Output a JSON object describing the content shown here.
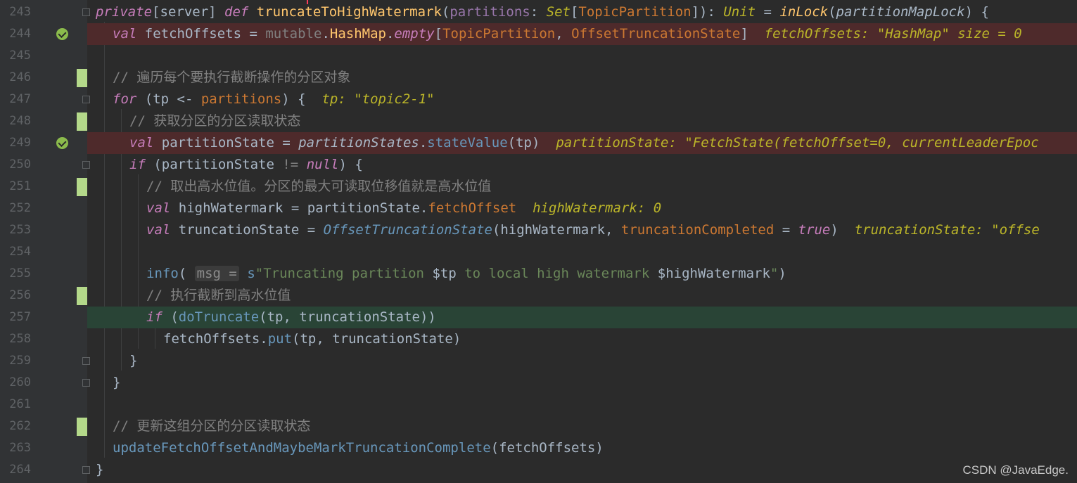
{
  "editor": {
    "lines": [
      {
        "num": "243",
        "code": "private[server] def truncateToHighWatermark(partitions: Set[TopicPartition]): Unit = inLock(partitionMapLock) {"
      },
      {
        "num": "244",
        "code": "val fetchOffsets = mutable.HashMap.empty[TopicPartition, OffsetTruncationState]",
        "hint": "fetchOffsets: \"HashMap\" size = 0"
      },
      {
        "num": "245",
        "code": ""
      },
      {
        "num": "246",
        "code": "// 遍历每个要执行截断操作的分区对象"
      },
      {
        "num": "247",
        "code": "for (tp <- partitions) {",
        "hint": "tp: \"topic2-1\""
      },
      {
        "num": "248",
        "code": "// 获取分区的分区读取状态"
      },
      {
        "num": "249",
        "code": "val partitionState = partitionStates.stateValue(tp)",
        "hint": "partitionState: \"FetchState(fetchOffset=0, currentLeaderEpoc"
      },
      {
        "num": "250",
        "code": "if (partitionState != null) {"
      },
      {
        "num": "251",
        "code": "// 取出高水位值。分区的最大可读取位移值就是高水位值"
      },
      {
        "num": "252",
        "code": "val highWatermark = partitionState.fetchOffset",
        "hint": "highWatermark: 0"
      },
      {
        "num": "253",
        "code": "val truncationState = OffsetTruncationState(highWatermark, truncationCompleted = true)",
        "hint": "truncationState: \"offse"
      },
      {
        "num": "254",
        "code": ""
      },
      {
        "num": "255",
        "code": "info( msg = s\"Truncating partition $tp to local high watermark $highWatermark\")"
      },
      {
        "num": "256",
        "code": "// 执行截断到高水位值"
      },
      {
        "num": "257",
        "code": "if (doTruncate(tp, truncationState))"
      },
      {
        "num": "258",
        "code": "fetchOffsets.put(tp, truncationState)"
      },
      {
        "num": "259",
        "code": "}"
      },
      {
        "num": "260",
        "code": "}"
      },
      {
        "num": "261",
        "code": ""
      },
      {
        "num": "262",
        "code": "// 更新这组分区的分区读取状态"
      },
      {
        "num": "263",
        "code": "updateFetchOffsetAndMaybeMarkTruncationComplete(fetchOffsets)"
      },
      {
        "num": "264",
        "code": "}"
      }
    ]
  },
  "watermark": "CSDN @JavaEdge.",
  "colors": {
    "background": "#2b2b2b",
    "breakpoint_line": "#4e2a2b",
    "execution_line": "#294436",
    "vcs_changed": "#b4d98a"
  }
}
